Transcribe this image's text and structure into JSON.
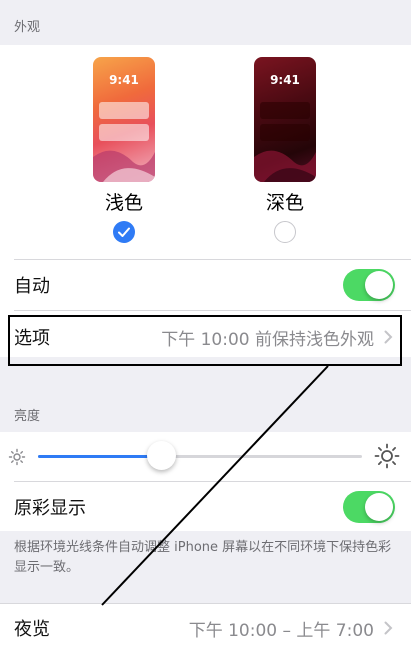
{
  "appearance": {
    "section_title": "外观",
    "preview_time": "9:41",
    "light_label": "浅色",
    "dark_label": "深色",
    "selected": "light"
  },
  "auto_row": {
    "label": "自动",
    "enabled": true
  },
  "options_row": {
    "label": "选项",
    "value": "下午 10:00 前保持浅色外观"
  },
  "brightness": {
    "section_title": "亮度",
    "level": 0.38
  },
  "true_tone": {
    "label": "原彩显示",
    "enabled": true,
    "footnote": "根据环境光线条件自动调整 iPhone 屏幕以在不同环境下保持色彩显示一致。"
  },
  "night_shift": {
    "label": "夜览",
    "value": "下午 10:00 – 上午 7:00"
  },
  "colors": {
    "accent": "#2f7bf5",
    "toggle_on": "#4cd964"
  }
}
